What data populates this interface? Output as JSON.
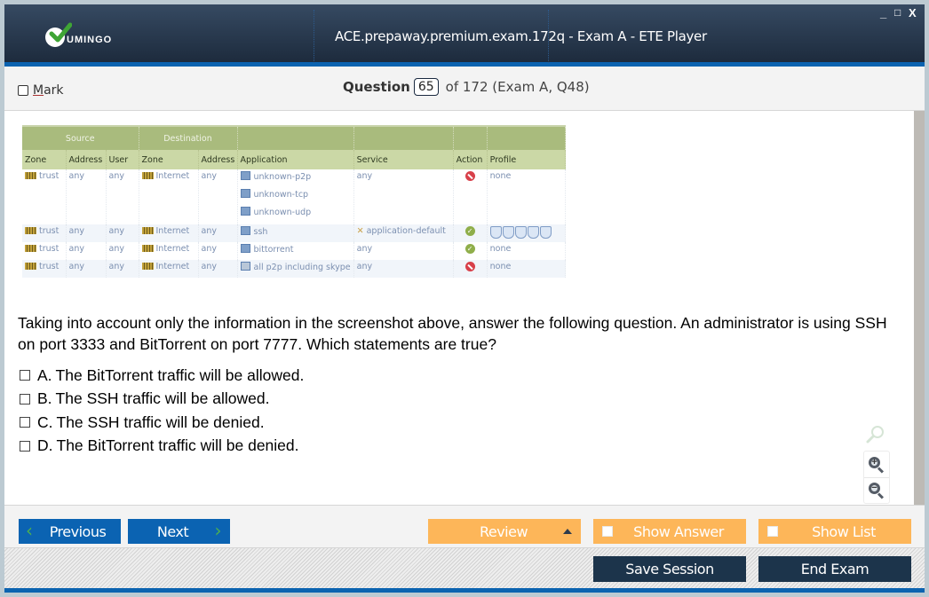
{
  "window": {
    "app_logo_text": "UMINGO",
    "title": "ACE.prepaway.premium.exam.172q - Exam A - ETE Player",
    "controls": {
      "minimize": "_",
      "maximize": "□",
      "close": "X"
    }
  },
  "header": {
    "mark_label_underlined": "M",
    "mark_label_rest": "ark",
    "mark_checked": false,
    "question_label": "Question",
    "question_number": "65",
    "question_of": "of 172 (Exam A, Q48)"
  },
  "exhibit": {
    "group_headers": {
      "source": "Source",
      "destination": "Destination"
    },
    "columns": [
      "Zone",
      "Address",
      "User",
      "Zone",
      "Address",
      "Application",
      "Service",
      "Action",
      "Profile"
    ],
    "rows": [
      {
        "src_zone": "trust",
        "src_addr": "any",
        "user": "any",
        "dst_zone": "Internet",
        "dst_addr": "any",
        "apps": [
          "unknown-p2p",
          "unknown-tcp",
          "unknown-udp"
        ],
        "service": "any",
        "action": "deny",
        "profile": "none"
      },
      {
        "src_zone": "trust",
        "src_addr": "any",
        "user": "any",
        "dst_zone": "Internet",
        "dst_addr": "any",
        "apps": [
          "ssh"
        ],
        "service": "application-default",
        "action": "allow",
        "profile": "profile-icons"
      },
      {
        "src_zone": "trust",
        "src_addr": "any",
        "user": "any",
        "dst_zone": "Internet",
        "dst_addr": "any",
        "apps": [
          "bittorrent"
        ],
        "service": "any",
        "action": "allow",
        "profile": "none"
      },
      {
        "src_zone": "trust",
        "src_addr": "any",
        "user": "any",
        "dst_zone": "Internet",
        "dst_addr": "any",
        "apps": [
          "all p2p including skype"
        ],
        "service": "any",
        "action": "deny",
        "profile": "none"
      }
    ]
  },
  "question": {
    "text": "Taking into account only the information in the screenshot above, answer the following question. An administrator is using SSH on port 3333 and BitTorrent on port 7777. Which statements are true?",
    "options": [
      {
        "letter": "A.",
        "text": "The BitTorrent traffic will be allowed.",
        "checked": false
      },
      {
        "letter": "B.",
        "text": "The SSH traffic will be allowed.",
        "checked": false
      },
      {
        "letter": "C.",
        "text": "The SSH traffic will be denied.",
        "checked": false
      },
      {
        "letter": "D.",
        "text": "The BitTorrent traffic will be denied.",
        "checked": false
      }
    ]
  },
  "nav": {
    "previous": "Previous",
    "next": "Next",
    "review": "Review",
    "show_answer": "Show Answer",
    "show_list": "Show List",
    "save_session": "Save Session",
    "end_exam": "End Exam"
  },
  "colors": {
    "title_bar": "#1d2b3d",
    "accent_blue": "#0b63b2",
    "orange": "#fdb659",
    "dark_button": "#1c344b",
    "table_header": "#a9bb7d"
  }
}
